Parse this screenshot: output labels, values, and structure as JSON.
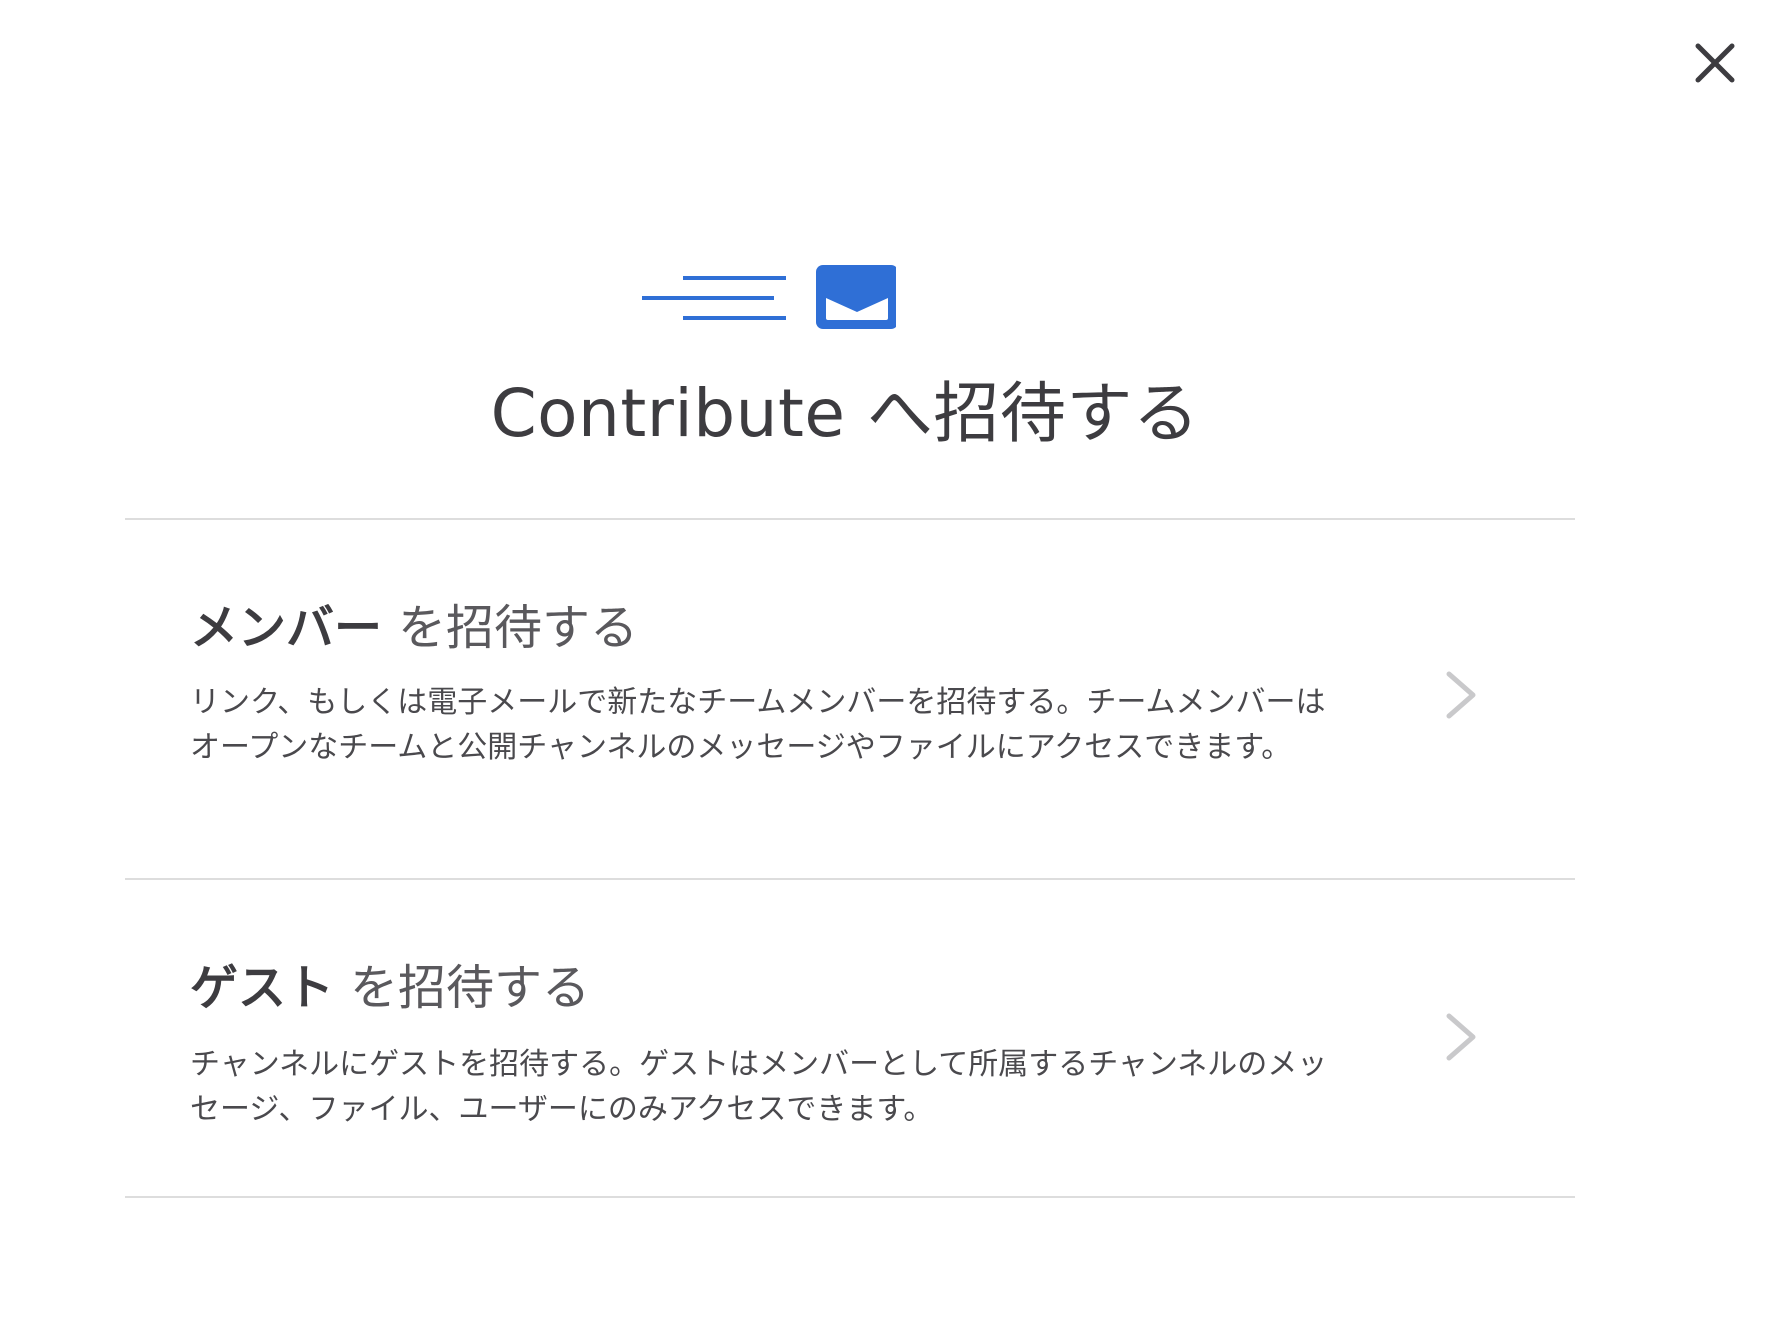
{
  "modal": {
    "title": "Contribute へ招待する",
    "accent_color": "#2f6fd6"
  },
  "options": [
    {
      "heading_strong": "メンバー",
      "heading_rest": "を招待する",
      "description": "リンク、もしくは電子メールで新たなチームメンバーを招待する。チームメンバーはオープンなチームと公開チャンネルのメッセージやファイルにアクセスできます。"
    },
    {
      "heading_strong": "ゲスト",
      "heading_rest": "を招待する",
      "description": "チャンネルにゲストを招待する。ゲストはメンバーとして所属するチャンネルのメッセージ、ファイル、ユーザーにのみアクセスできます。"
    }
  ],
  "icons": {
    "close": "close-icon",
    "header": "send-mail-icon",
    "chevron": "chevron-right-icon"
  }
}
